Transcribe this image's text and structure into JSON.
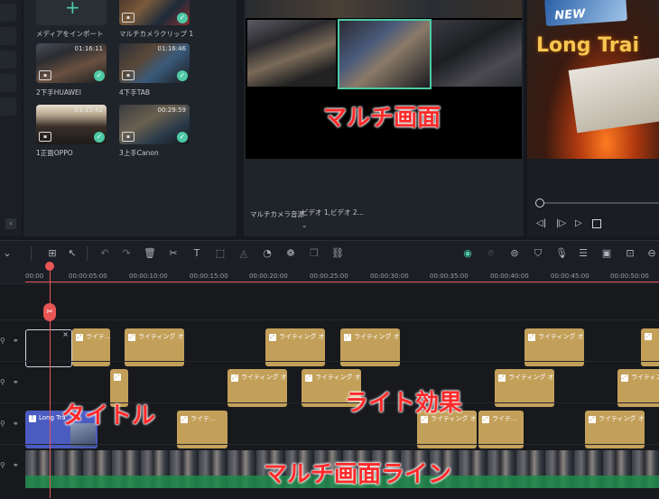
{
  "media": {
    "items": [
      {
        "label": "メディアをインポート",
        "duration": ""
      },
      {
        "label": "マルチカメラクリップ 1",
        "duration": ""
      },
      {
        "label": "2下手HUAWEI",
        "duration": "01:16:11"
      },
      {
        "label": "4下手TAB",
        "duration": "01:16:46"
      },
      {
        "label": "1正面OPPO",
        "duration": "01:15:42"
      },
      {
        "label": "3上手Canon",
        "duration": "00:29:59"
      }
    ]
  },
  "preview": {
    "source_label": "マルチカメラ音源",
    "source_value": "ビデオ 1,ビデオ 2..."
  },
  "player": {
    "title_text": "Long Trai",
    "sign_text": "NEW"
  },
  "ruler": {
    "ticks": [
      "00:00",
      "00:00:05:00",
      "00:00:10:00",
      "00:00:15:00",
      "00:00:20:00",
      "00:00:25:00",
      "00:00:30:00",
      "00:00:35:00",
      "00:00:40:00",
      "00:00:45:00",
      "00:00:50:00"
    ]
  },
  "timeline": {
    "lighting_label": "ライティング オ...",
    "lighting_short": "ライテ...",
    "title_clip_label": "Long Tra"
  },
  "annotations": {
    "multi_screen": "マルチ画面",
    "title": "タイトル",
    "light_effect": "ライト効果",
    "multi_screen_line": "マルチ画面ライン"
  },
  "colors": {
    "accent": "#4ec9a5",
    "playhead": "#e85555",
    "clip": "#c3a05a",
    "title_clip": "#4b5cc0",
    "annotation": "#ff2a2a"
  }
}
